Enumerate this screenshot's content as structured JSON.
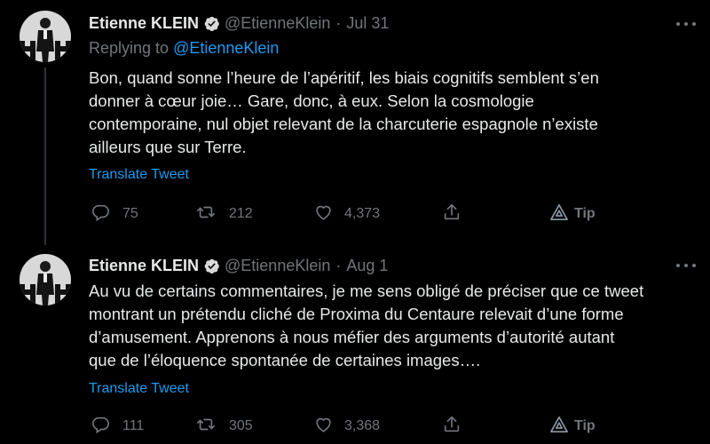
{
  "tweets": [
    {
      "author": {
        "name": "Etienne KLEIN",
        "handle": "@EtienneKlein",
        "verified": true
      },
      "separator": "·",
      "date": "Jul 31",
      "replying_prefix": "Replying to",
      "replying_to": "@EtienneKlein",
      "text_lines": [
        "Bon, quand sonne l’heure de l’apéritif, les biais cognitifs semblent s’en",
        "donner  à cœur joie… Gare, donc, à eux. Selon la cosmologie",
        "contemporaine, nul objet relevant de la charcuterie espagnole n’existe",
        "ailleurs que sur Terre."
      ],
      "translate_label": "Translate Tweet",
      "stats": {
        "replies": "75",
        "retweets": "212",
        "likes": "4,373",
        "tip_label": "Tip"
      }
    },
    {
      "author": {
        "name": "Etienne KLEIN",
        "handle": "@EtienneKlein",
        "verified": true
      },
      "separator": "·",
      "date": "Aug 1",
      "text_lines": [
        "Au vu de certains commentaires, je me sens obligé de préciser que ce tweet",
        "montrant un prétendu cliché de Proxima du Centaure relevait d’une  forme",
        "d’amusement. Apprenons à nous méfier des arguments d’autorité autant",
        "que de l’éloquence spontanée de certaines images…."
      ],
      "translate_label": "Translate Tweet",
      "stats": {
        "replies": "111",
        "retweets": "305",
        "likes": "3,368",
        "tip_label": "Tip"
      }
    }
  ],
  "icons": {
    "more": "more-horizontal-icon",
    "verified": "verified-badge-icon",
    "reply": "reply-icon",
    "retweet": "retweet-icon",
    "like": "heart-icon",
    "share": "share-icon",
    "tip": "tip-icon"
  },
  "colors": {
    "background": "#000000",
    "text": "#e7e9ea",
    "secondary": "#71767b",
    "link": "#1d9bf0",
    "divider": "#2f3336"
  }
}
